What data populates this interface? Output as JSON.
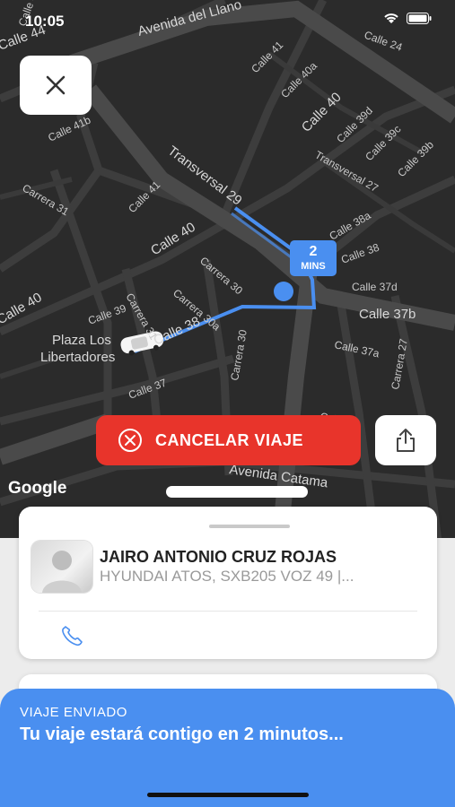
{
  "status_bar": {
    "time": "10:05"
  },
  "map": {
    "streets": [
      "Calle 45",
      "Avenida del Llano",
      "Calle 44",
      "Calle 41",
      "Calle 40a",
      "Calle 40",
      "Calle 41b",
      "Calle 39d",
      "Calle 39c",
      "Transversal 29",
      "Transversal 27",
      "Calle 39b",
      "Carrera 31",
      "Calle 41",
      "Calle 40",
      "Calle 38a",
      "Calle 38",
      "Carrera 30",
      "Calle 37d",
      "Calle 39",
      "Carrera 31",
      "Carrera 30a",
      "Calle 37b",
      "Calle 40",
      "Calle 38",
      "Calle 37a",
      "Carrera 30",
      "Carrera 27",
      "Calle 37",
      "Calle 36",
      "Avenida Catama",
      "Calle 24"
    ],
    "poi_line1": "Plaza Los",
    "poi_line2": "Libertadores",
    "google_label": "Google",
    "eta_value": "2",
    "eta_unit": "MINS",
    "route_color": "#4a8ff0"
  },
  "actions": {
    "cancel_label": "CANCELAR VIAJE",
    "cancel_color": "#e8342b"
  },
  "driver": {
    "name": "JAIRO ANTONIO CRUZ ROJAS",
    "vehicle": "HYUNDAI ATOS, SXB205 VOZ 49 |..."
  },
  "trip_status": {
    "kicker": "VIAJE ENVIADO",
    "message": "Tu viaje estará contigo en 2 minutos...",
    "panel_color": "#4a8ff0"
  }
}
